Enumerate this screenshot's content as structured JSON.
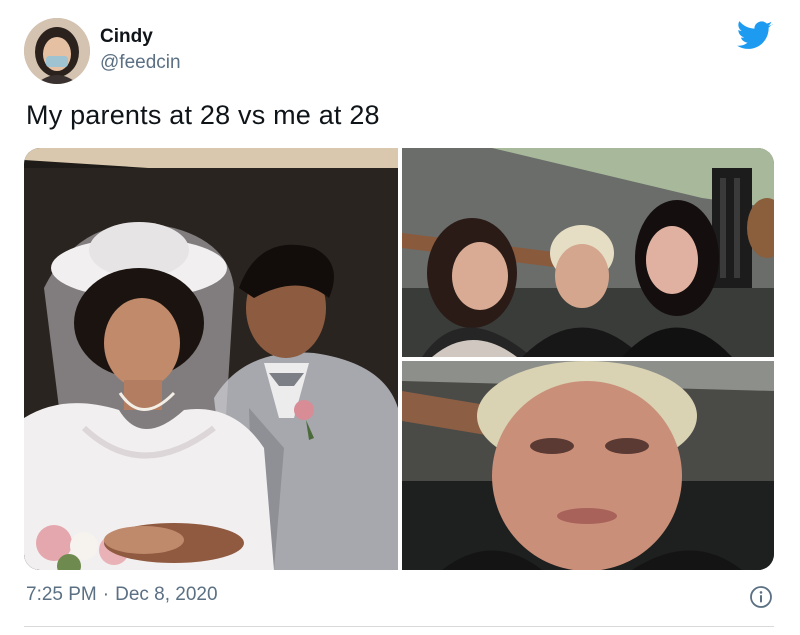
{
  "user": {
    "name": "Cindy",
    "handle": "@feedcin",
    "avatar_icon": "profile-photo-masked-person"
  },
  "brand": {
    "icon": "twitter-bird-icon",
    "color": "#1d9bf0"
  },
  "tweet": {
    "text": "My parents at 28 vs me at 28",
    "time": "7:25 PM",
    "separator": "·",
    "date": "Dec 8, 2020"
  },
  "media": {
    "photos": [
      {
        "id": "wedding",
        "subject": "bride-and-groom-wedding-photo"
      },
      {
        "id": "three-women",
        "subject": "three-women-group-selfie"
      },
      {
        "id": "closeup",
        "subject": "blurry-closeup-face"
      }
    ]
  },
  "icons": {
    "info": "info-icon"
  }
}
